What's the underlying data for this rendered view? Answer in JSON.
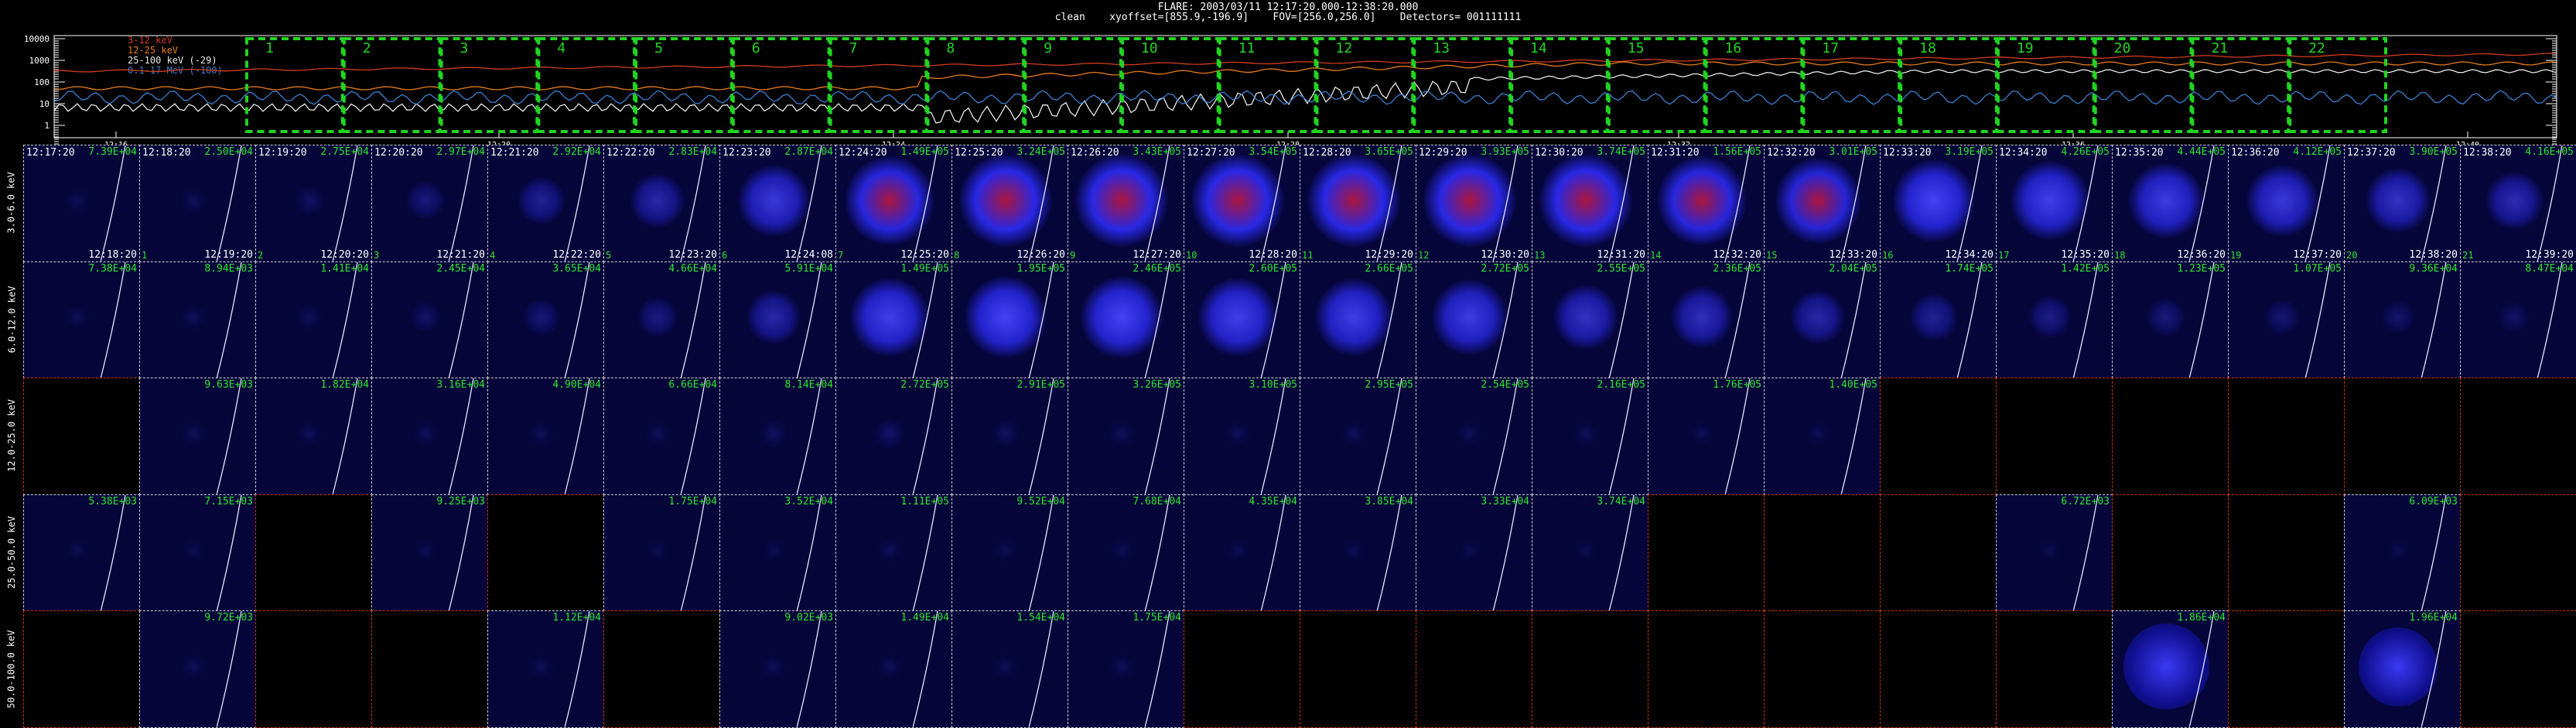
{
  "header": {
    "line1": "FLARE: 2003/03/11 12:17:20.000-12:38:20.000",
    "line2": "clean    xyoffset=[855.9,-196.9]    FOV=[256.0,256.0]    Detectors= 001111111"
  },
  "legend": [
    {
      "label": "3-12 keV",
      "color": "#d43c1e"
    },
    {
      "label": "12-25 keV",
      "color": "#e87b18"
    },
    {
      "label": "25-100 keV (-29)",
      "color": "#e8e8e8"
    },
    {
      "label": "0.1-17 MeV (-100)",
      "color": "#3a7fd0"
    }
  ],
  "lightcurve": {
    "y_ticks": [
      "10000",
      "1000",
      "100",
      "10",
      "1"
    ],
    "x_ticks": [
      "12:16",
      "12:20",
      "12:24",
      "12:28",
      "12:32",
      "12:36",
      "12:40"
    ],
    "interval_labels": [
      "1",
      "2",
      "3",
      "4",
      "5",
      "6",
      "7",
      "8",
      "9",
      "10",
      "11",
      "12",
      "13",
      "14",
      "15",
      "16",
      "17",
      "18",
      "19",
      "20",
      "21",
      "22"
    ]
  },
  "colors": {
    "interval_box": "#22d422",
    "counts": "#2ee62e",
    "cell_border": "#cfcfcf",
    "empty_border": "#cc3a00"
  },
  "energy_bands": [
    "3.0-6.0 keV",
    "6.0-12.0 keV",
    "12.0-25.0 keV",
    "25.0-50.0 keV",
    "50.0-100.0 keV"
  ],
  "start_times": [
    "12:17:20",
    "12:18:20",
    "12:19:20",
    "12:20:20",
    "12:21:20",
    "12:22:20",
    "12:23:20",
    "12:24:20",
    "12:25:20",
    "12:26:20",
    "12:27:20",
    "12:28:20",
    "12:29:20",
    "12:30:20",
    "12:31:20",
    "12:32:20",
    "12:33:20",
    "12:34:20",
    "12:35:20",
    "12:36:20",
    "12:37:20",
    "12:38:20"
  ],
  "end_times": [
    "12:18:20",
    "12:19:20",
    "12:20:20",
    "12:21:20",
    "12:22:20",
    "12:23:20",
    "12:24:08",
    "12:25:20",
    "12:26:20",
    "12:27:20",
    "12:28:20",
    "12:29:20",
    "12:30:20",
    "12:31:20",
    "12:32:20",
    "12:33:20",
    "12:34:20",
    "12:35:20",
    "12:36:20",
    "12:37:20",
    "12:38:20",
    "12:39:20"
  ],
  "rows": [
    {
      "cells": [
        {
          "c": "7.39E+04",
          "b": 0.05
        },
        {
          "c": "2.50E+04",
          "b": 0.06
        },
        {
          "c": "2.75E+04",
          "b": 0.1
        },
        {
          "c": "2.97E+04",
          "b": 0.22
        },
        {
          "c": "2.92E+04",
          "b": 0.35
        },
        {
          "c": "2.83E+04",
          "b": 0.45
        },
        {
          "c": "2.87E+04",
          "b": 0.7
        },
        {
          "c": "1.49E+05",
          "b": 0.95,
          "r": 1
        },
        {
          "c": "3.24E+05",
          "b": 1,
          "r": 1
        },
        {
          "c": "3.43E+05",
          "b": 1,
          "r": 1
        },
        {
          "c": "3.54E+05",
          "b": 1,
          "r": 1
        },
        {
          "c": "3.65E+05",
          "b": 1,
          "r": 1
        },
        {
          "c": "3.93E+05",
          "b": 1,
          "r": 1
        },
        {
          "c": "3.74E+05",
          "b": 1,
          "r": 1
        },
        {
          "c": "1.56E+05",
          "b": 0.95,
          "r": 1
        },
        {
          "c": "3.01E+05",
          "b": 0.9,
          "r": 1
        },
        {
          "c": "3.19E+05",
          "b": 0.85
        },
        {
          "c": "4.26E+05",
          "b": 0.8
        },
        {
          "c": "4.44E+05",
          "b": 0.75
        },
        {
          "c": "4.12E+05",
          "b": 0.7
        },
        {
          "c": "3.90E+05",
          "b": 0.6
        },
        {
          "c": "4.16E+05",
          "b": 0.5
        }
      ]
    },
    {
      "cells": [
        {
          "c": "7.38E+04",
          "b": 0.05
        },
        {
          "c": "8.94E+03",
          "b": 0.06
        },
        {
          "c": "1.41E+04",
          "b": 0.06
        },
        {
          "c": "2.45E+04",
          "b": 0.12
        },
        {
          "c": "3.65E+04",
          "b": 0.2
        },
        {
          "c": "4.66E+04",
          "b": 0.25
        },
        {
          "c": "5.91E+04",
          "b": 0.45
        },
        {
          "c": "1.49E+05",
          "b": 0.8
        },
        {
          "c": "1.95E+05",
          "b": 0.85
        },
        {
          "c": "2.46E+05",
          "b": 0.85
        },
        {
          "c": "2.60E+05",
          "b": 0.8
        },
        {
          "c": "2.66E+05",
          "b": 0.78
        },
        {
          "c": "2.72E+05",
          "b": 0.75
        },
        {
          "c": "2.55E+05",
          "b": 0.6
        },
        {
          "c": "2.36E+05",
          "b": 0.55
        },
        {
          "c": "2.04E+05",
          "b": 0.45
        },
        {
          "c": "1.74E+05",
          "b": 0.35
        },
        {
          "c": "1.42E+05",
          "b": 0.28
        },
        {
          "c": "1.23E+05",
          "b": 0.22
        },
        {
          "c": "1.07E+05",
          "b": 0.18
        },
        {
          "c": "9.36E+04",
          "b": 0.15
        },
        {
          "c": "8.47E+04",
          "b": 0.12
        }
      ]
    },
    {
      "cells": [
        {
          "e": 1
        },
        {
          "c": "9.63E+03",
          "b": 0.05
        },
        {
          "c": "1.82E+04",
          "b": 0.05
        },
        {
          "c": "3.16E+04",
          "b": 0.05
        },
        {
          "c": "4.90E+04",
          "b": 0.05
        },
        {
          "c": "6.66E+04",
          "b": 0.05
        },
        {
          "c": "8.14E+04",
          "b": 0.08
        },
        {
          "c": "2.72E+05",
          "b": 0.12
        },
        {
          "c": "2.91E+05",
          "b": 0.08
        },
        {
          "c": "3.26E+05",
          "b": 0.06
        },
        {
          "c": "3.10E+05",
          "b": 0.05
        },
        {
          "c": "2.95E+05",
          "b": 0.05
        },
        {
          "c": "2.54E+05",
          "b": 0.05
        },
        {
          "c": "2.16E+05",
          "b": 0.05
        },
        {
          "c": "1.76E+05",
          "b": 0.04
        },
        {
          "c": "1.40E+05",
          "b": 0.04
        },
        {
          "e": 1
        },
        {
          "e": 1
        },
        {
          "e": 1
        },
        {
          "e": 1
        },
        {
          "e": 1
        },
        {
          "e": 1
        }
      ]
    },
    {
      "cells": [
        {
          "c": "5.38E+03",
          "b": 0.03
        },
        {
          "c": "7.15E+03",
          "b": 0.03
        },
        {
          "e": 1
        },
        {
          "c": "9.25E+03",
          "b": 0.03
        },
        {
          "e": 1
        },
        {
          "c": "1.75E+04",
          "b": 0.03
        },
        {
          "c": "3.52E+04",
          "b": 0.03
        },
        {
          "c": "1.11E+05",
          "b": 0.05
        },
        {
          "c": "9.52E+04",
          "b": 0.04
        },
        {
          "c": "7.68E+04",
          "b": 0.04
        },
        {
          "c": "4.35E+04",
          "b": 0.03
        },
        {
          "c": "3.85E+04",
          "b": 0.03
        },
        {
          "c": "3.33E+04",
          "b": 0.03
        },
        {
          "c": "3.74E+04",
          "b": 0.03
        },
        {
          "e": 1
        },
        {
          "e": 1
        },
        {
          "e": 1
        },
        {
          "c": "6.72E+03",
          "b": 0.03
        },
        {
          "e": 1
        },
        {
          "e": 1
        },
        {
          "c": "6.09E+03",
          "b": 0.03
        },
        {
          "e": 1
        }
      ]
    },
    {
      "cells": [
        {
          "e": 1
        },
        {
          "c": "9.72E+03",
          "b": 0.05
        },
        {
          "e": 1
        },
        {
          "e": 1
        },
        {
          "c": "1.12E+04",
          "b": 0.05
        },
        {
          "e": 1
        },
        {
          "c": "9.02E+03",
          "b": 0.05
        },
        {
          "c": "1.49E+04",
          "b": 0.05
        },
        {
          "c": "1.54E+04",
          "b": 0.05
        },
        {
          "c": "1.75E+04",
          "b": 0.05
        },
        {
          "e": 1
        },
        {
          "e": 1
        },
        {
          "e": 1
        },
        {
          "e": 1
        },
        {
          "e": 1
        },
        {
          "e": 1
        },
        {
          "e": 1
        },
        {
          "e": 1
        },
        {
          "c": "1.86E+04",
          "b": 0.9,
          "noise": 1
        },
        {
          "e": 1
        },
        {
          "c": "1.96E+04",
          "b": 0.8,
          "noise": 1
        },
        {
          "e": 1
        }
      ]
    }
  ]
}
